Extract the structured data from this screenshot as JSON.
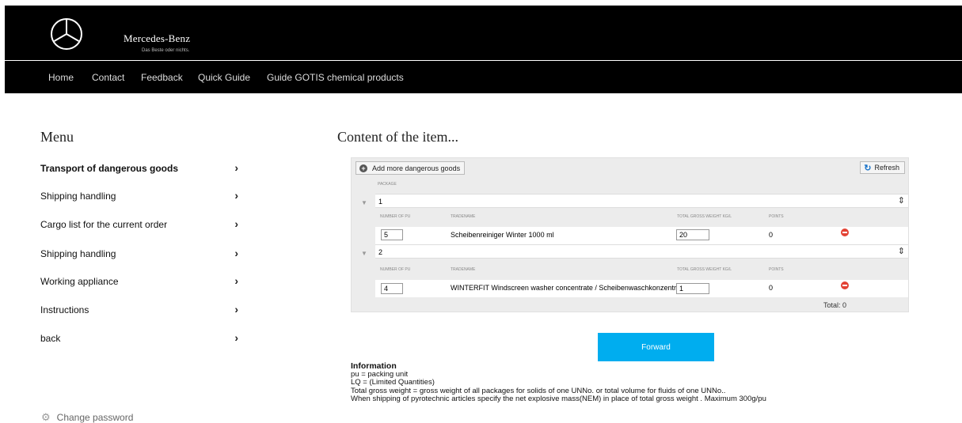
{
  "brand": {
    "name": "Mercedes-Benz",
    "slogan": "Das Beste oder nichts."
  },
  "nav": {
    "items": [
      {
        "label": "Home"
      },
      {
        "label": "Contact"
      },
      {
        "label": "Feedback"
      },
      {
        "label": "Quick Guide"
      },
      {
        "label": "Guide GOTIS chemical products"
      }
    ]
  },
  "sidebar": {
    "title": "Menu",
    "items": [
      {
        "label": "Transport of dangerous goods",
        "active": true
      },
      {
        "label": "Shipping handling"
      },
      {
        "label": "Cargo list for the current order"
      },
      {
        "label": "Shipping handling"
      },
      {
        "label": "Working appliance"
      },
      {
        "label": "Instructions"
      },
      {
        "label": "back"
      }
    ],
    "change_password": "Change password"
  },
  "main": {
    "title": "Content of the item...",
    "toolbar": {
      "add_label": "Add more dangerous goods",
      "refresh_label": "Refresh"
    },
    "package_header": "PACKAGE",
    "columns": {
      "number_of_pu": "NUMBER OF PU",
      "tradename": "TRADENAME",
      "total_gross_weight": "TOTAL GROSS WEIGHT KG/L",
      "points": "POINTS"
    },
    "packages": [
      {
        "number": "1",
        "item": {
          "pu": "5",
          "tradename": "Scheibenreiniger Winter 1000 ml",
          "weight": "20",
          "points": "0"
        }
      },
      {
        "number": "2",
        "item": {
          "pu": "4",
          "tradename": "WINTERFIT Windscreen washer concentrate / Scheibenwaschkonzentrat",
          "weight": "1",
          "points": "0"
        }
      }
    ],
    "total_label": "Total: 0",
    "forward_label": "Forward"
  },
  "info": {
    "title": "Information",
    "lines": [
      "pu = packing unit",
      "LQ = (Limited Quantities)",
      "Total gross weight = gross weight of all packages for solids of one UNNo. or total volume for fluids of one UNNo..",
      "When shipping of pyrotechnic articles specify the net explosive mass(NEM) in place of total gross weight . Maximum 300g/pu"
    ]
  },
  "icons": [
    "mercedes-star-logo",
    "chevron-right-icon",
    "gear-icon",
    "plus-circle-icon",
    "refresh-icon",
    "triangle-down-icon",
    "spinner-icon",
    "remove-icon"
  ],
  "colors": {
    "header_bg": "#000000",
    "forward_button": "#00adef",
    "remove_icon": "#e34234",
    "refresh_icon": "#1a73c9"
  }
}
